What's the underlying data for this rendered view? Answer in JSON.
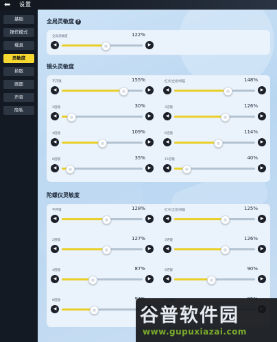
{
  "header": {
    "back_icon": "arrow-left-icon",
    "back_glyph": "⬅",
    "title": "设置"
  },
  "menu": [
    {
      "label": "基础",
      "active": false
    },
    {
      "label": "操作模式",
      "active": false
    },
    {
      "label": "载具",
      "active": false
    },
    {
      "label": "灵敏度",
      "active": true
    },
    {
      "label": "拾取",
      "active": false
    },
    {
      "label": "画面",
      "active": false
    },
    {
      "label": "声音",
      "active": false
    },
    {
      "label": "隐私",
      "active": false
    }
  ],
  "sections": {
    "global": {
      "title": "全局灵敏度",
      "help_glyph": "?",
      "sliders": [
        {
          "label": "全局灵敏度",
          "value": "122%",
          "fraction": 0.54
        }
      ]
    },
    "scope": {
      "title": "镜头灵敏度",
      "sliders": [
        {
          "label": "不开镜",
          "value": "155%",
          "fraction": 0.76
        },
        {
          "label": "红点/全息/机瞄",
          "value": "148%",
          "fraction": 0.66
        },
        {
          "label": "2倍镜",
          "value": "30%",
          "fraction": 0.12
        },
        {
          "label": "3倍镜",
          "value": "126%",
          "fraction": 0.63
        },
        {
          "label": "4倍镜",
          "value": "109%",
          "fraction": 0.5
        },
        {
          "label": "6倍镜",
          "value": "114%",
          "fraction": 0.54
        },
        {
          "label": "8倍镜",
          "value": "35%",
          "fraction": 0.1
        },
        {
          "label": "15倍镜",
          "value": "40%",
          "fraction": 0.15
        }
      ]
    },
    "gyro": {
      "title": "陀螺仪灵敏度",
      "sliders": [
        {
          "label": "不开镜",
          "value": "128%",
          "fraction": 0.55
        },
        {
          "label": "红点/全息/机瞄",
          "value": "125%",
          "fraction": 0.63
        },
        {
          "label": "2倍镜",
          "value": "127%",
          "fraction": 0.55
        },
        {
          "label": "3倍镜",
          "value": "126%",
          "fraction": 0.63
        },
        {
          "label": "4倍镜",
          "value": "87%",
          "fraction": 0.38
        },
        {
          "label": "6倍镜",
          "value": "90%",
          "fraction": 0.46
        },
        {
          "label": "8倍镜",
          "value": "94%",
          "fraction": 0.4
        },
        {
          "label": "15倍镜",
          "value": "85%",
          "fraction": 0.3
        }
      ]
    }
  },
  "icons": {
    "left": "◀",
    "right": "▶"
  },
  "watermark": {
    "logo": "谷普软件园",
    "url": "www.gupuxiazai.com"
  }
}
